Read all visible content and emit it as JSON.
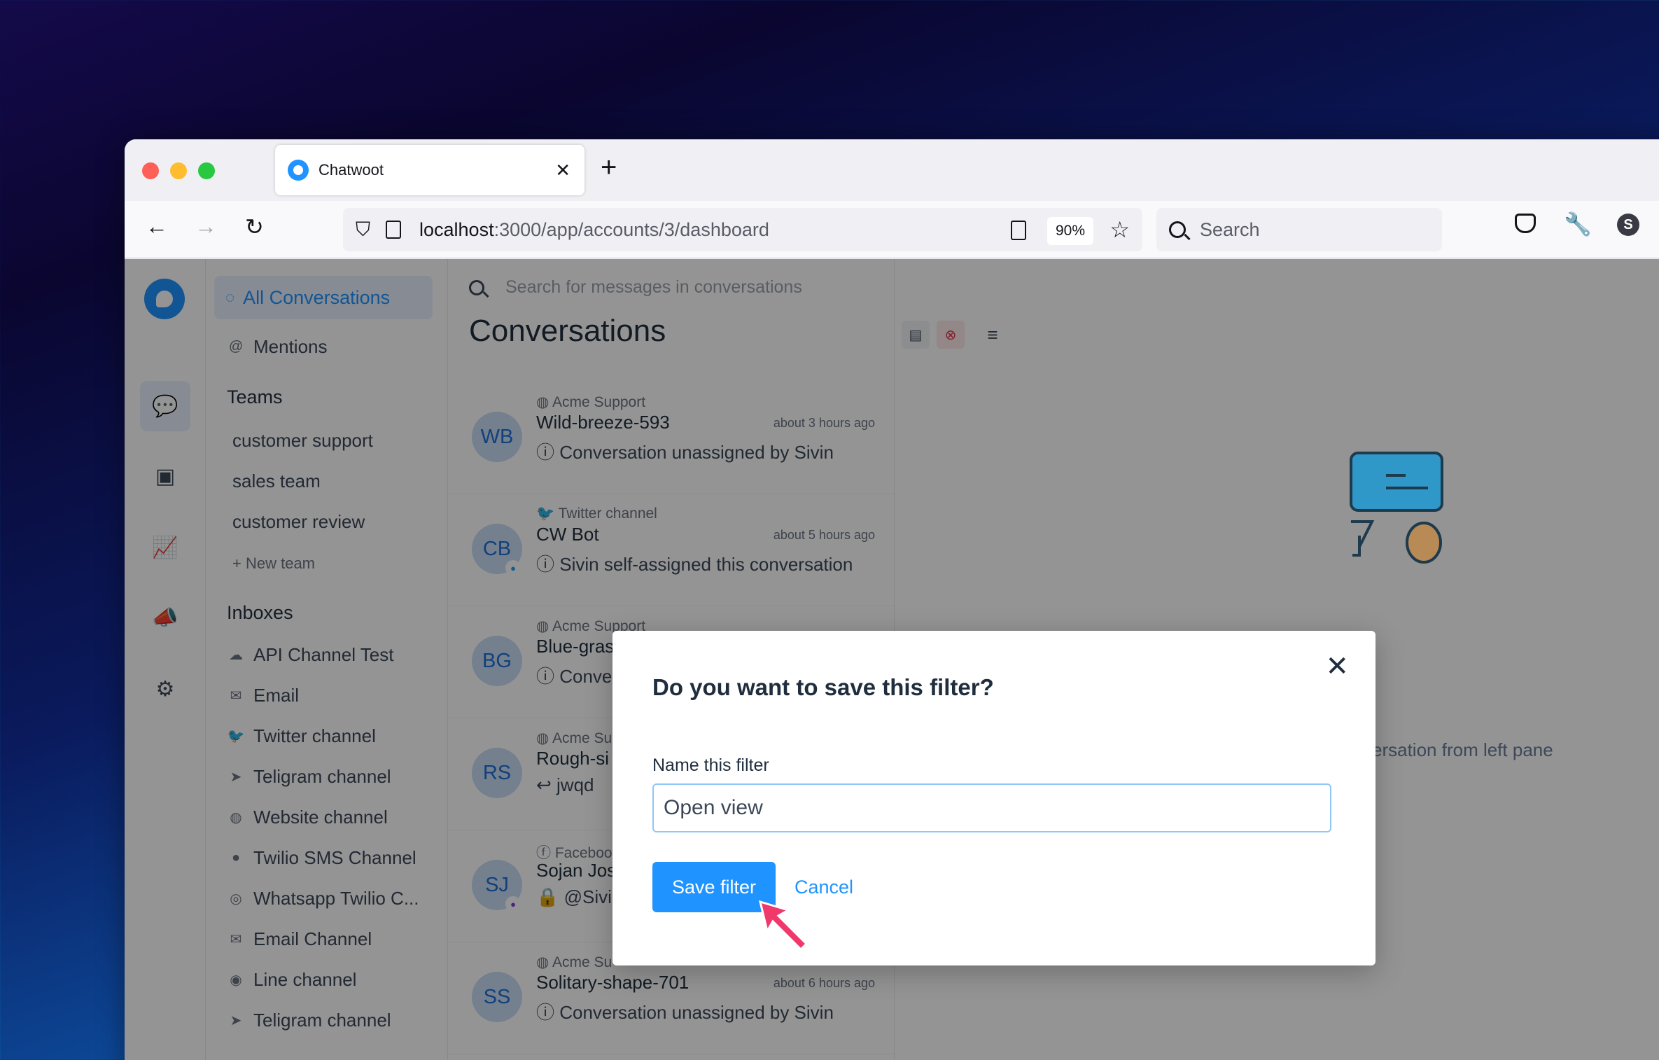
{
  "browser": {
    "tab_title": "Chatwoot",
    "url_host": "localhost",
    "url_path": ":3000/app/accounts/3/dashboard",
    "zoom": "90%",
    "search_label": "Search",
    "avatar_letter": "S"
  },
  "sidebar": {
    "active_item": "All Conversations",
    "mentions": "Mentions",
    "teams_heading": "Teams",
    "teams": [
      "customer support",
      "sales team",
      "customer review"
    ],
    "new_team": "New team",
    "inboxes_heading": "Inboxes",
    "inboxes": [
      {
        "label": "API Channel Test",
        "icon": "cloud-icon"
      },
      {
        "label": "Email",
        "icon": "mail-icon"
      },
      {
        "label": "Twitter channel",
        "icon": "twitter-icon"
      },
      {
        "label": "Teligram channel",
        "icon": "telegram-icon"
      },
      {
        "label": "Website channel",
        "icon": "globe-icon"
      },
      {
        "label": "Twilio SMS Channel",
        "icon": "sms-icon"
      },
      {
        "label": "Whatsapp Twilio C...",
        "icon": "whatsapp-icon"
      },
      {
        "label": "Email Channel",
        "icon": "mail-icon"
      },
      {
        "label": "Line channel",
        "icon": "line-icon"
      },
      {
        "label": "Teligram channel",
        "icon": "telegram-icon"
      }
    ]
  },
  "conversations": {
    "search_placeholder": "Search for messages in conversations",
    "title": "Conversations",
    "items": [
      {
        "initials": "WB",
        "inbox": "Acme Support",
        "name": "Wild-breeze-593",
        "time": "about 3 hours ago",
        "message": "Conversation unassigned by Sivin"
      },
      {
        "initials": "CB",
        "inbox": "Twitter channel",
        "name": "CW Bot",
        "time": "about 5 hours ago",
        "message": "Sivin self-assigned this conversation"
      },
      {
        "initials": "BG",
        "inbox": "Acme Support",
        "name": "Blue-gras",
        "time": "",
        "message": "Conve"
      },
      {
        "initials": "RS",
        "inbox": "Acme Su",
        "name": "Rough-si",
        "time": "",
        "message": "jwqd"
      },
      {
        "initials": "SJ",
        "inbox": "Faceboo",
        "name": "Sojan Jos",
        "time": "",
        "message": "@Sivin"
      },
      {
        "initials": "SS",
        "inbox": "Acme Su",
        "name": "Solitary-shape-701",
        "time": "about 6 hours ago",
        "message": "Conversation unassigned by Sivin"
      }
    ]
  },
  "empty_state": {
    "text": "ersation from left pane"
  },
  "modal": {
    "title": "Do you want to save this filter?",
    "label": "Name this filter",
    "input_value": "Open view",
    "save_label": "Save filter",
    "cancel_label": "Cancel"
  },
  "colors": {
    "accent": "#1f93ff",
    "danger": "#e0364f",
    "pointer": "#f0386b"
  }
}
